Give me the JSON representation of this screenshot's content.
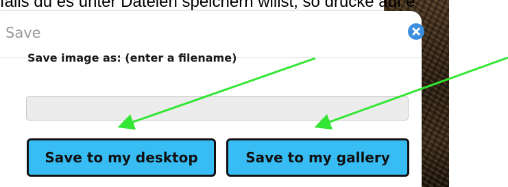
{
  "banner": {
    "text": "falls du es unter Dateien speichern willst, so drücke auf e"
  },
  "dialog": {
    "title": "Save",
    "close_icon": "close-icon",
    "prompt": "Save image as: (enter a filename)",
    "filename": {
      "value": "",
      "placeholder": ""
    },
    "buttons": {
      "desktop_label": "Save to my desktop",
      "gallery_label": "Save to my gallery"
    }
  },
  "colors": {
    "button_bg": "#37bcf4",
    "close_bg": "#3d8ede",
    "annotation_arrow": "#33e633"
  }
}
